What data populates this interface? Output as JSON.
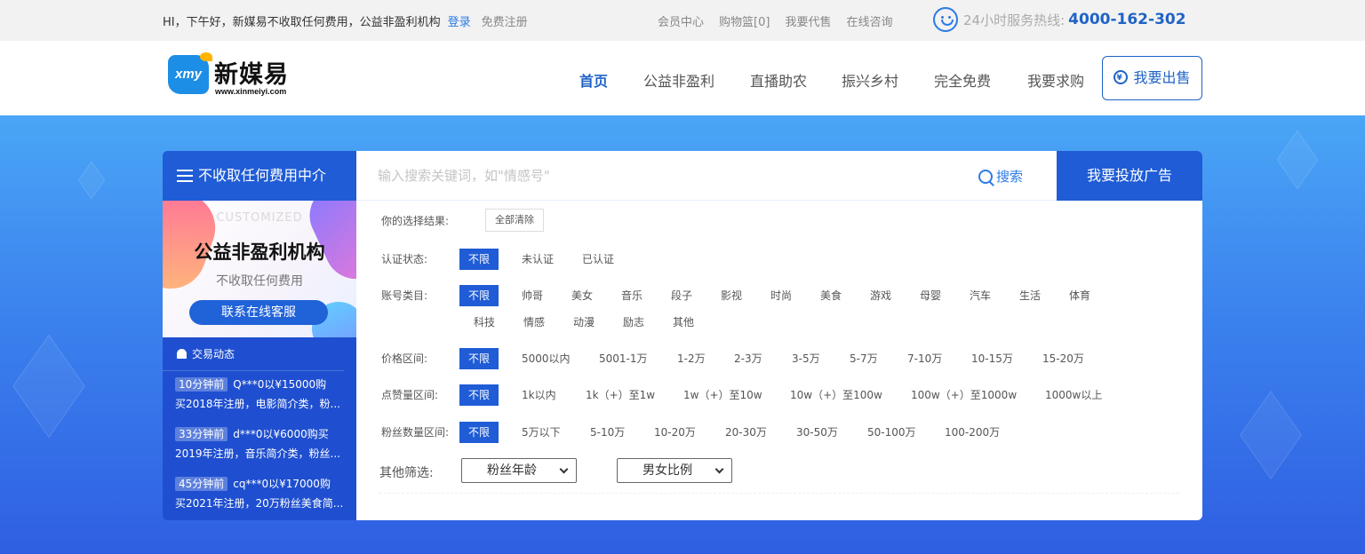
{
  "topbar": {
    "greeting": "HI，下午好，新媒易不收取任何费用，公益非盈利机构",
    "login": "登录",
    "register": "免费注册",
    "links": [
      "会员中心",
      "购物篮[0]",
      "我要代售",
      "在线咨询"
    ],
    "hotline_label": "24小时服务热线:",
    "hotline_number": "4000-162-302"
  },
  "header": {
    "logo_name": "新媒易",
    "logo_url": "www.xinmeiyi.com",
    "logo_mark": "xmy",
    "nav": [
      "首页",
      "公益非盈利",
      "直播助农",
      "振兴乡村",
      "完全免费",
      "我要求购"
    ],
    "sell_label": "我要出售"
  },
  "left": {
    "header": "不收取任何费用中介",
    "banner": {
      "tag": "CUSTOMIZED",
      "title": "公益非盈利机构",
      "subtitle": "不收取任何费用",
      "button": "联系在线客服"
    },
    "feed_title": "交易动态",
    "feed": [
      {
        "time": "10分钟前",
        "line1": "Q***0以¥15000购",
        "line2": "买2018年注册，电影简介类，粉..."
      },
      {
        "time": "33分钟前",
        "line1": "d***0以¥6000购买",
        "line2": "2019年注册，音乐简介类，粉丝..."
      },
      {
        "time": "45分钟前",
        "line1": "cq***0以¥17000购",
        "line2": "买2021年注册，20万粉丝美食简..."
      }
    ]
  },
  "search": {
    "placeholder": "输入搜索关键词，如\"情感号\"",
    "button": "搜索",
    "ad_button": "我要投放广告"
  },
  "filters": {
    "selection_label": "你的选择结果:",
    "clear_all": "全部清除",
    "auth": {
      "label": "认证状态:",
      "options": [
        "不限",
        "未认证",
        "已认证"
      ]
    },
    "category": {
      "label": "账号类目:",
      "options": [
        "不限",
        "帅哥",
        "美女",
        "音乐",
        "段子",
        "影视",
        "时尚",
        "美食",
        "游戏",
        "母婴",
        "汽车",
        "生活",
        "体育",
        "科技",
        "情感",
        "动漫",
        "励志",
        "其他"
      ]
    },
    "price": {
      "label": "价格区间:",
      "options": [
        "不限",
        "5000以内",
        "5001-1万",
        "1-2万",
        "2-3万",
        "3-5万",
        "5-7万",
        "7-10万",
        "10-15万",
        "15-20万"
      ]
    },
    "likes": {
      "label": "点赞量区间:",
      "options": [
        "不限",
        "1k以内",
        "1k（+）至1w",
        "1w（+）至10w",
        "10w（+）至100w",
        "100w（+）至1000w",
        "1000w以上"
      ]
    },
    "fans": {
      "label": "粉丝数量区间:",
      "options": [
        "不限",
        "5万以下",
        "5-10万",
        "10-20万",
        "20-30万",
        "30-50万",
        "50-100万",
        "100-200万"
      ]
    },
    "other": {
      "label": "其他筛选:",
      "fan_age": "粉丝年龄",
      "gender_ratio": "男女比例"
    }
  }
}
